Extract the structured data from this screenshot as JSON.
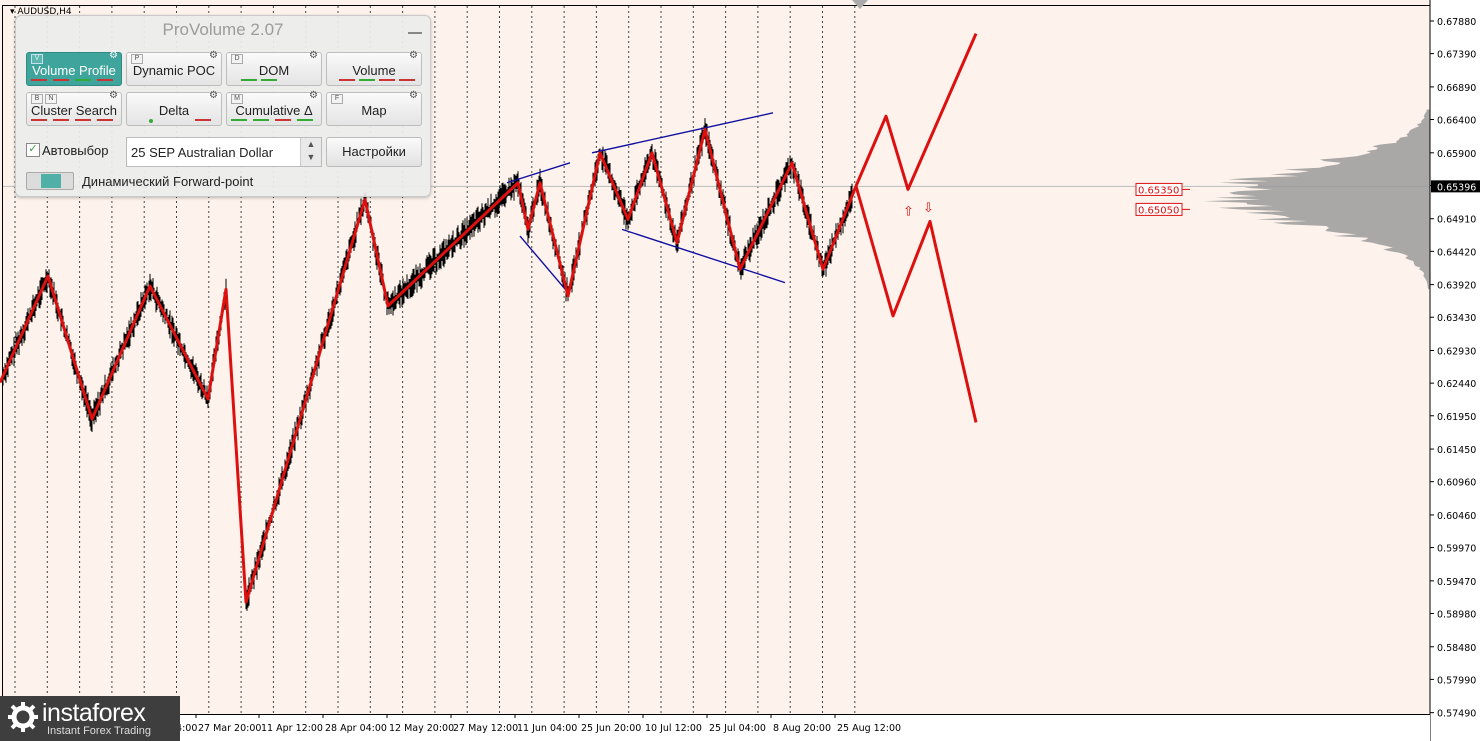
{
  "symbol": "AUDUSD,H4",
  "current_price": "0.65396",
  "levels": [
    {
      "label": "0.65350",
      "value": 0.6535
    },
    {
      "label": "0.65050",
      "value": 0.6505
    }
  ],
  "price_axis": {
    "min": 0.5747,
    "max": 0.6788,
    "ticks": [
      "0.67880",
      "0.67390",
      "0.66890",
      "0.66400",
      "0.65900",
      "0.65410",
      "0.64910",
      "0.64420",
      "0.63920",
      "0.63430",
      "0.62930",
      "0.62440",
      "0.61950",
      "0.61450",
      "0.60960",
      "0.60460",
      "0.59970",
      "0.59470",
      "0.58980",
      "0.58480",
      "0.57990",
      "0.57490"
    ]
  },
  "time_axis": {
    "labels": [
      "27 Mar 20:00",
      "11 Apr 12:00",
      "28 Apr 04:00",
      "12 May 20:00",
      "27 May 12:00",
      "11 Jun 04:00",
      "25 Jun 20:00",
      "10 Jul 12:00",
      "25 Jul 04:00",
      "8 Aug 20:00",
      "25 Aug 12:00"
    ],
    "partial_labels": [
      "1",
      "2 Mar 04:00"
    ]
  },
  "zigzag": [
    [
      0,
      0.6245
    ],
    [
      48,
      0.6405
    ],
    [
      92,
      0.619
    ],
    [
      150,
      0.639
    ],
    [
      208,
      0.622
    ],
    [
      226,
      0.6385
    ],
    [
      246,
      0.5915
    ],
    [
      365,
      0.652
    ],
    [
      388,
      0.636
    ],
    [
      518,
      0.6545
    ],
    [
      528,
      0.6475
    ],
    [
      540,
      0.6545
    ],
    [
      568,
      0.6375
    ],
    [
      600,
      0.659
    ],
    [
      628,
      0.649
    ],
    [
      652,
      0.659
    ],
    [
      677,
      0.6455
    ],
    [
      705,
      0.6625
    ],
    [
      740,
      0.6415
    ],
    [
      792,
      0.6575
    ],
    [
      823,
      0.6415
    ],
    [
      856,
      0.654
    ]
  ],
  "projection_up": [
    [
      856,
      0.654
    ],
    [
      886,
      0.6645
    ],
    [
      908,
      0.6535
    ],
    [
      976,
      0.6769
    ]
  ],
  "projection_down": [
    [
      856,
      0.654
    ],
    [
      893,
      0.6345
    ],
    [
      930,
      0.6487
    ],
    [
      976,
      0.6185
    ]
  ],
  "channels": [
    [
      [
        520,
        0.6465
      ],
      [
        568,
        0.638
      ]
    ],
    [
      [
        507,
        0.6545
      ],
      [
        570,
        0.6575
      ]
    ],
    [
      [
        592,
        0.659
      ],
      [
        773,
        0.665
      ]
    ],
    [
      [
        622,
        0.6475
      ],
      [
        785,
        0.6395
      ]
    ]
  ],
  "signal_arrows": {
    "up": "⇧",
    "down": "⇩"
  },
  "panel": {
    "title": "ProVolume 2.07",
    "tools": [
      {
        "key": "V",
        "label": "Volume Profile",
        "active": true
      },
      {
        "key": "P",
        "label": "Dynamic POC"
      },
      {
        "key": "D",
        "label": "DOM"
      },
      {
        "key": "",
        "label": "Volume"
      },
      {
        "key": "B N",
        "label": "Cluster Search"
      },
      {
        "key": "",
        "label": "Delta"
      },
      {
        "key": "M",
        "label": "Cumulative Δ"
      },
      {
        "key": "F",
        "label": "Map"
      }
    ],
    "auto_select_label": "Автовыбор",
    "instrument": "25 SEP Australian Dollar",
    "settings_label": "Настройки",
    "forward_point_label": "Динамический Forward-point"
  },
  "watermark": {
    "name": "instaforex",
    "tagline": "Instant Forex Trading"
  },
  "colors": {
    "background": "#fdf3ec",
    "zigzag": "#dd1010",
    "channel": "#1010a0",
    "profile": "#9a9a9a",
    "accent": "#3fa59c"
  }
}
